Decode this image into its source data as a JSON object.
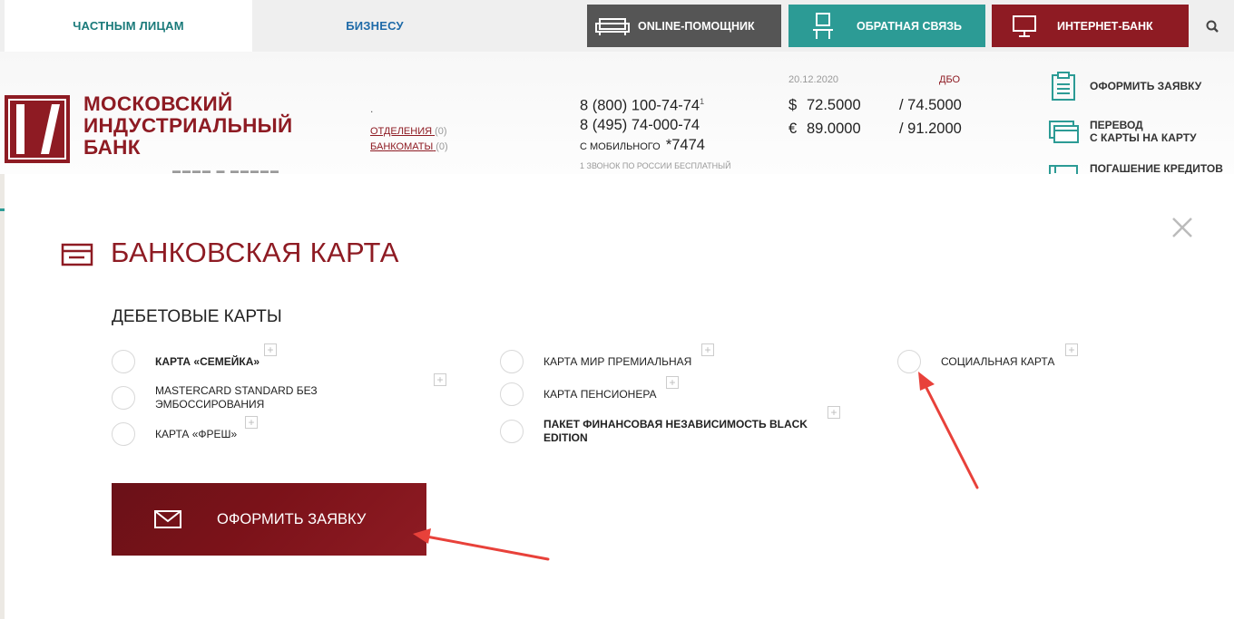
{
  "nav": {
    "tabs": [
      {
        "label": "ЧАСТНЫМ ЛИЦАМ"
      },
      {
        "label": "БИЗНЕСУ"
      }
    ],
    "buttons": {
      "online": "ONLINE-ПОМОЩНИК",
      "feedback": "ОБРАТНАЯ СВЯЗЬ",
      "ibank": "ИНТЕРНЕТ-БАНК"
    },
    "icons": [
      "sofa-icon",
      "person-icon",
      "monitor-icon",
      "search-icon"
    ]
  },
  "header": {
    "logo_lines": [
      "МОСКОВСКИЙ",
      "ИНДУСТРИАЛЬНЫЙ",
      "БАНК"
    ],
    "dot": ".",
    "branches": {
      "label": "ОТДЕЛЕНИЯ",
      "count": "(0)"
    },
    "atms": {
      "label": "БАНКОМАТЫ",
      "count": "(0)"
    },
    "phone1": "8 (800) 100-74-74",
    "phone1_sup": "1",
    "phone2": "8 (495) 74-000-74",
    "mobile_label": "С МОБИЛЬНОГО",
    "mobile_number": "*7474",
    "free_call_note": "1 ЗВОНОК ПО РОССИИ БЕСПЛАТНЫЙ",
    "rates": {
      "date": "20.12.2020",
      "dbo": "ДБО",
      "usd": {
        "symbol": "$",
        "buy": "72.5000",
        "sell": "/ 74.5000"
      },
      "eur": {
        "symbol": "€",
        "buy": "89.0000",
        "sell": "/ 91.2000"
      }
    },
    "actions": {
      "apply": "ОФОРМИТЬ ЗАЯВКУ",
      "transfer_line1": "ПЕРЕВОД",
      "transfer_line2": "С КАРТЫ НА КАРТУ",
      "loan": "ПОГАШЕНИЕ КРЕДИТОВ"
    }
  },
  "modal": {
    "title": "БАНКОВСКАЯ КАРТА",
    "subtitle": "ДЕБЕТОВЫЕ КАРТЫ",
    "options": {
      "semeyka": "КАРТА «СЕМЕЙКА»",
      "mastercard_line1": "MASTERCARD STANDARD БЕЗ",
      "mastercard_line2": "ЭМБОССИРОВАНИЯ",
      "fresh": "КАРТА «ФРЕШ»",
      "mir_premium": "КАРТА МИР ПРЕМИАЛЬНАЯ",
      "pensioner": "КАРТА ПЕНСИОНЕРА",
      "black_line1": "ПАКЕТ ФИНАНСОВАЯ НЕЗАВИСИМОСТЬ BLACK",
      "black_line2": "EDITION",
      "social": "СОЦИАЛЬНАЯ КАРТА"
    },
    "plus_symbol": "+",
    "submit": "ОФОРМИТЬ ЗАЯВКУ"
  },
  "colors": {
    "brand": "#8e1b23",
    "teal": "#2c9b95",
    "gray_button": "#555555",
    "annotation_arrow": "#e8413a"
  }
}
